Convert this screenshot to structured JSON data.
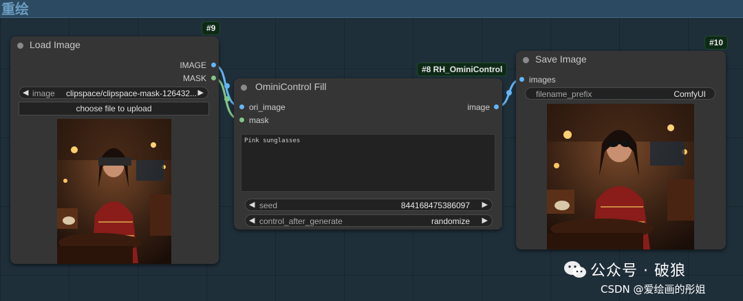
{
  "group": {
    "title": "重绘"
  },
  "nodes": {
    "load_image": {
      "badge": "#9",
      "title": "Load Image",
      "outputs": {
        "image": "IMAGE",
        "mask": "MASK"
      },
      "image_widget": {
        "label": "image",
        "value": "clipspace/clipspace-mask-126432..."
      },
      "upload_button": "choose file to upload"
    },
    "omini_fill": {
      "badge": "#8 RH_OminiControl",
      "title": "OminiControl Fill",
      "inputs": {
        "ori_image": "ori_image",
        "mask": "mask"
      },
      "outputs": {
        "image": "image"
      },
      "prompt": "Pink sunglasses",
      "seed": {
        "label": "seed",
        "value": "844168475386097"
      },
      "control_after_generate": {
        "label": "control_after_generate",
        "value": "randomize"
      }
    },
    "save_image": {
      "badge": "#10",
      "title": "Save Image",
      "inputs": {
        "images": "images"
      },
      "filename_prefix": {
        "label": "filename_prefix",
        "value": "ComfyUI"
      }
    }
  },
  "watermark": {
    "wechat": "公众号 · 破狼",
    "csdn": "CSDN @爱绘画的彤姐"
  },
  "colors": {
    "image_link": "#64b5f6",
    "mask_link": "#81c784",
    "badge_bg": "#0e2a17",
    "group_band": "#2c4a62"
  },
  "icons": {
    "arrow_left": "◀",
    "arrow_right": "▶"
  }
}
